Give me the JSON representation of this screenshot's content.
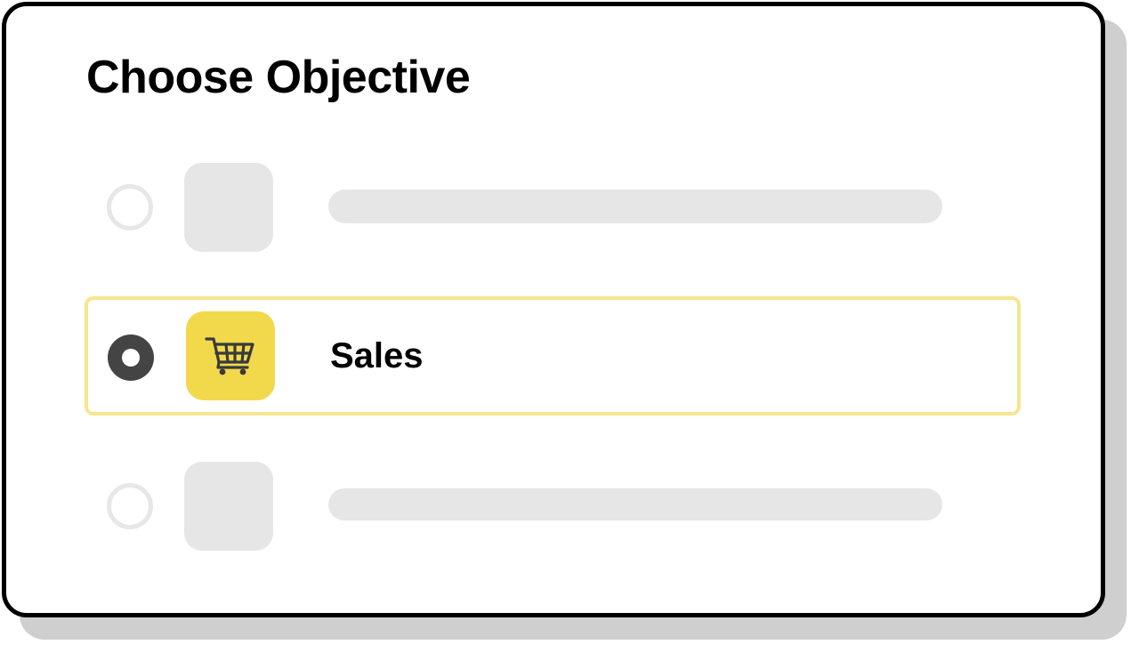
{
  "dialog": {
    "title": "Choose Objective"
  },
  "options": [
    {
      "label": "",
      "selected": false,
      "icon": "placeholder-icon"
    },
    {
      "label": "Sales",
      "selected": true,
      "icon": "shopping-cart-icon"
    },
    {
      "label": "",
      "selected": false,
      "icon": "placeholder-icon"
    }
  ],
  "colors": {
    "accent": "#f2d94c",
    "selected_border": "#f7e58f",
    "placeholder": "#e6e6e6",
    "radio_selected": "#444444",
    "card_border": "#000000",
    "shadow": "#cfcfcf"
  }
}
